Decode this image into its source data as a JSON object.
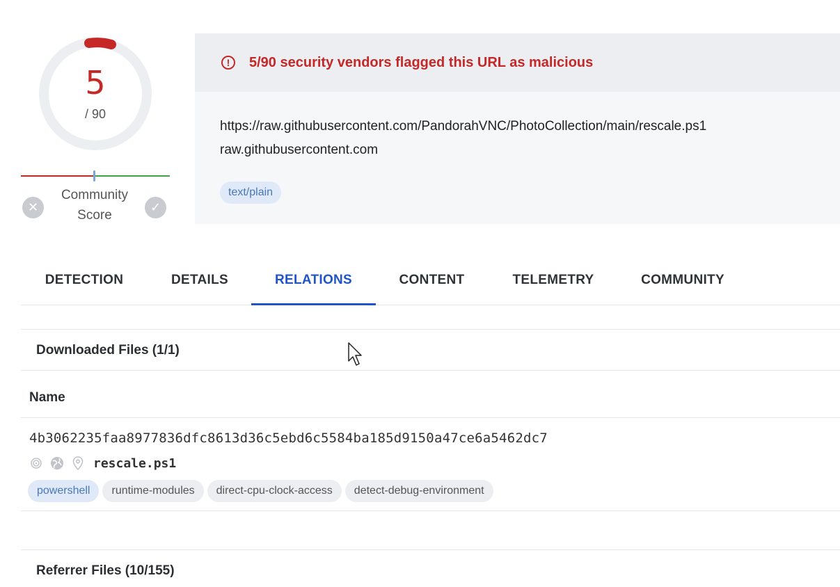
{
  "score": {
    "detections": "5",
    "total": "/ 90",
    "community_label": "Community\nScore",
    "accent_color": "#c62828"
  },
  "alert": {
    "text": "5/90 security vendors flagged this URL as malicious"
  },
  "url": {
    "full": "https://raw.githubusercontent.com/PandorahVNC/PhotoCollection/main/rescale.ps1",
    "domain": "raw.githubusercontent.com",
    "content_type": "text/plain"
  },
  "tabs": [
    {
      "label": "DETECTION"
    },
    {
      "label": "DETAILS"
    },
    {
      "label": "RELATIONS",
      "active": true
    },
    {
      "label": "CONTENT"
    },
    {
      "label": "TELEMETRY"
    },
    {
      "label": "COMMUNITY"
    }
  ],
  "downloaded_files": {
    "title": "Downloaded Files (1/1)",
    "column_name": "Name",
    "rows": [
      {
        "hash": "4b3062235faa8977836dfc8613d36c5ebd6c5584ba185d9150a47ce6a5462dc7",
        "filename": "rescale.ps1",
        "tags": [
          "powershell",
          "runtime-modules",
          "direct-cpu-clock-access",
          "detect-debug-environment"
        ]
      }
    ]
  },
  "referrer_files": {
    "title": "Referrer Files (10/155)"
  }
}
